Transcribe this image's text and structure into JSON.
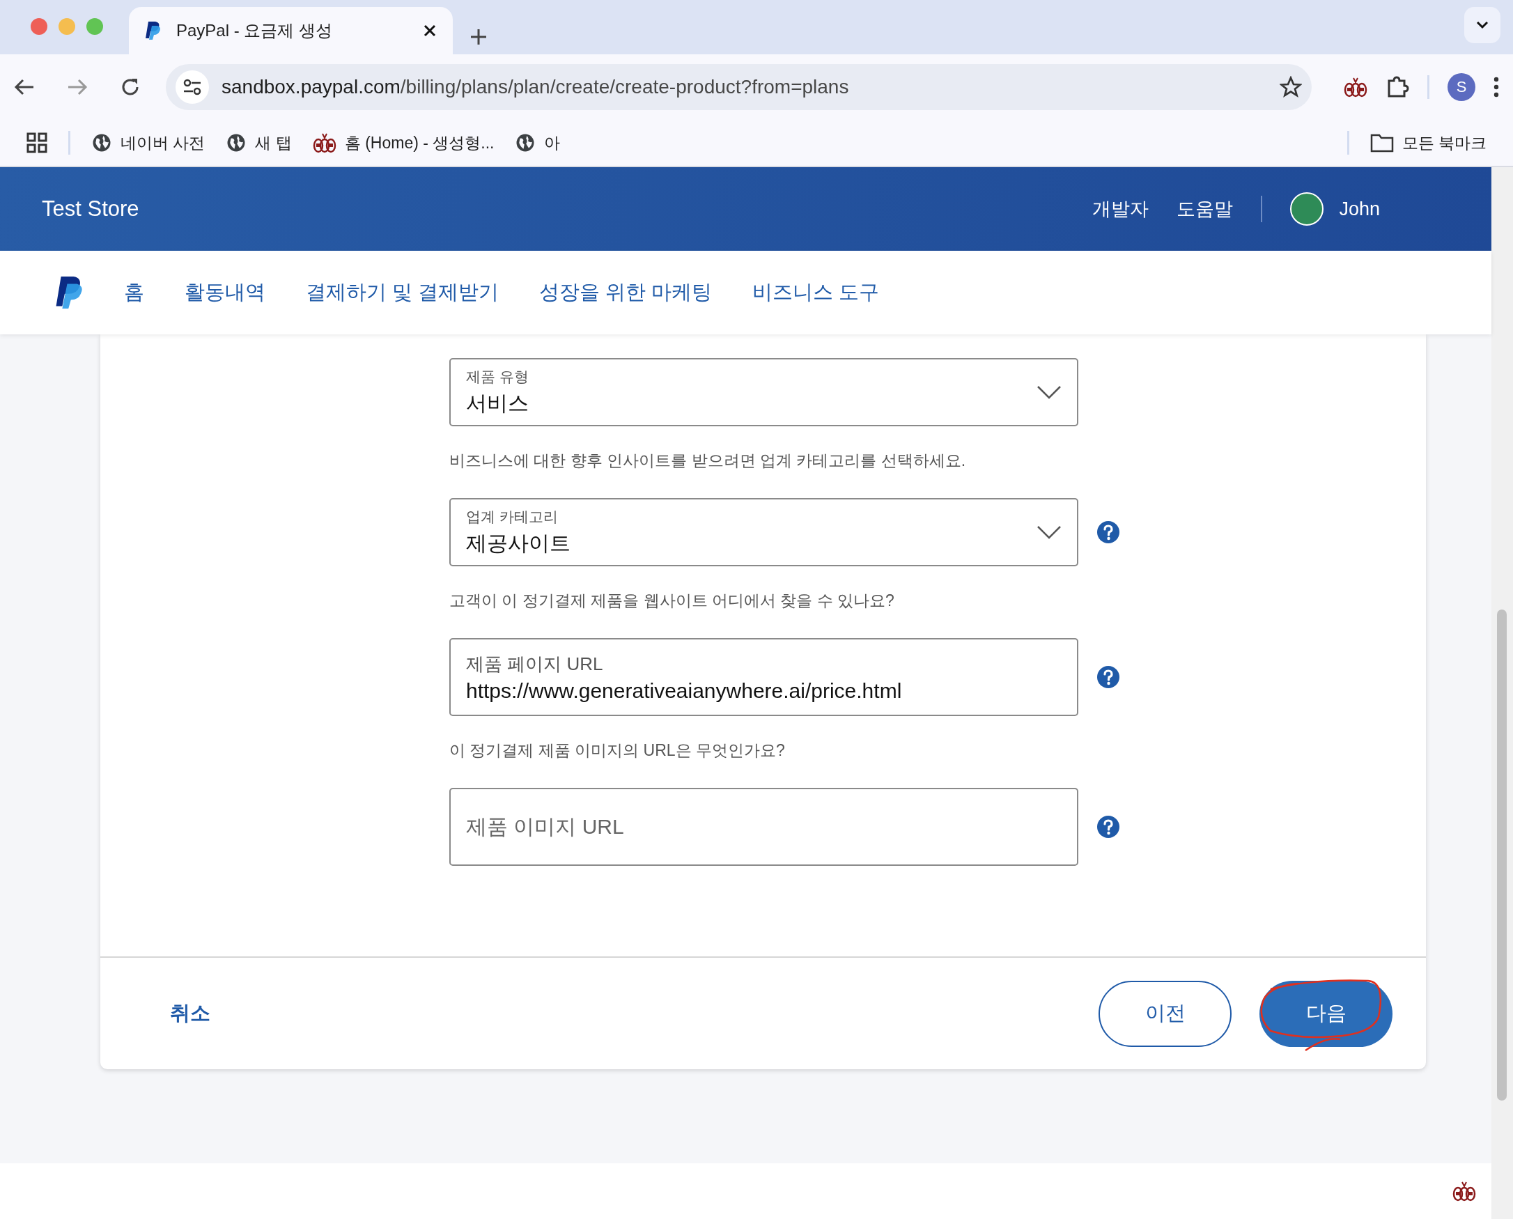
{
  "browser": {
    "tab_title": "PayPal - 요금제 생성",
    "url_host": "sandbox.paypal.com",
    "url_path": "/billing/plans/plan/create/create-product?from=plans",
    "profile_initial": "S",
    "bookmarks": [
      {
        "kind": "globe",
        "label": "네이버 사전"
      },
      {
        "kind": "globe",
        "label": "새 탭"
      },
      {
        "kind": "pins",
        "label": "홈 (Home) - 생성형..."
      },
      {
        "kind": "globe",
        "label": "아"
      }
    ],
    "all_bookmarks": "모든 북마크"
  },
  "header": {
    "store_name": "Test Store",
    "links": [
      "개발자",
      "도움말"
    ],
    "user_name": "John"
  },
  "nav": {
    "items": [
      "홈",
      "활동내역",
      "결제하기 및 결제받기",
      "성장을 위한 마케팅",
      "비즈니스 도구"
    ]
  },
  "form": {
    "items": [
      {
        "kind": "select",
        "label": "제품 유형",
        "value": "서비스",
        "help": false
      },
      {
        "kind": "prompt",
        "text": "비즈니스에 대한 향후 인사이트를 받으려면 업계 카테고리를 선택하세요."
      },
      {
        "kind": "select",
        "label": "업계 카테고리",
        "value": "제공사이트",
        "help": true
      },
      {
        "kind": "prompt",
        "text": "고객이 이 정기결제 제품을 웹사이트 어디에서 찾을 수 있나요?"
      },
      {
        "kind": "text",
        "label": "제품 페이지 URL",
        "value": "https://www.generativeaianywhere.ai/price.html",
        "help": true
      },
      {
        "kind": "prompt",
        "text": "이 정기결제 제품 이미지의 URL은 무엇인가요?"
      },
      {
        "kind": "text",
        "placeholder": "제품 이미지 URL",
        "help": true
      }
    ]
  },
  "footer": {
    "cancel": "취소",
    "previous": "이전",
    "next": "다음"
  }
}
